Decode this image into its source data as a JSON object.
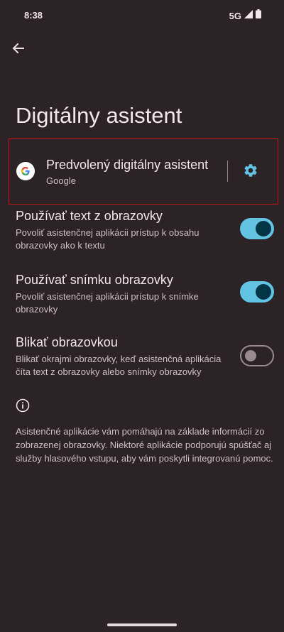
{
  "status_bar": {
    "time": "8:38",
    "network": "5G",
    "signal_icon": "signal-icon",
    "battery_icon": "battery-icon"
  },
  "header": {
    "back_icon": "arrow-back-icon",
    "title": "Digitálny asistent"
  },
  "default_assistant": {
    "title": "Predvolený digitálny asistent",
    "subtitle": "Google",
    "logo": "google-logo",
    "settings_icon": "gear-icon"
  },
  "options": [
    {
      "title": "Používať text z obrazovky",
      "summary": "Povoliť asistenčnej aplikácii prístup k obsahu obrazovky ako k textu",
      "enabled": true
    },
    {
      "title": "Používať snímku obrazovky",
      "summary": "Povoliť asistenčnej aplikácii prístup k snímke obrazovky",
      "enabled": true
    },
    {
      "title": "Blikať obrazovkou",
      "summary": "Blikať okrajmi obrazovky, keď asistenčná aplikácia číta text z obrazovky alebo snímky obrazovky",
      "enabled": false
    }
  ],
  "footer": {
    "info_icon": "info-icon",
    "text": "Asistenčné aplikácie vám pomáhajú na základe informácií zo zobrazenej obrazovky. Niektoré aplikácie podporujú spúšťač aj služby hlasového vstupu, aby vám poskytli integrovanú pomoc."
  },
  "colors": {
    "background": "#2b2326",
    "accent": "#62c3e3",
    "highlight_border": "#c6141b"
  }
}
